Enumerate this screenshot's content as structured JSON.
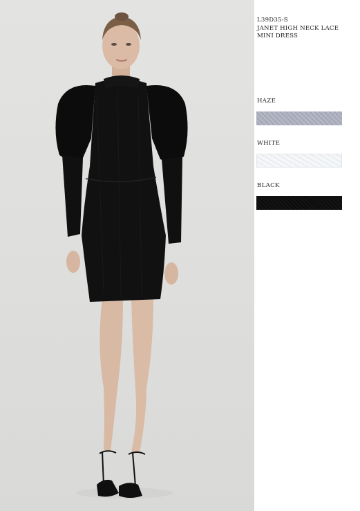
{
  "product": {
    "code": "L39D35-S",
    "name": "JANET HIGH NECK LACE MINI DRESS"
  },
  "swatches": [
    {
      "label": "HAZE",
      "color": "#a9acbb"
    },
    {
      "label": "WHITE",
      "color": "#f4f6f8"
    },
    {
      "label": "BLACK",
      "color": "#0d0d0d"
    }
  ]
}
